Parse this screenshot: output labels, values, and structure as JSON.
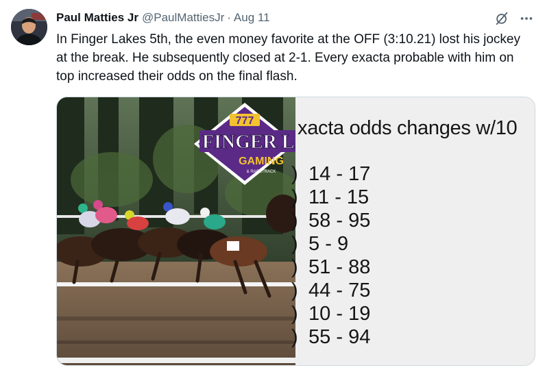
{
  "tweet": {
    "author": {
      "display_name": "Paul Matties Jr",
      "handle": "@PaulMattiesJr",
      "separator": "·",
      "date": "Aug 11"
    },
    "text": "In Finger Lakes 5th, the even money favorite at the OFF (3:10.21) lost his jockey at the break. He subsequently closed at 2-1. Every exacta probable with him on top increased their odds on the final flash."
  },
  "media": {
    "logo_text": {
      "top": "777",
      "main": "FINGER LAK",
      "sub": "GAMING",
      "small": "& RACETRACK"
    },
    "odds_panel": {
      "heading": "xacta odds changes w/10",
      "rows": [
        {
          "prefix": ")",
          "value": " 14 - 17"
        },
        {
          "prefix": ")",
          "value": " 11 - 15"
        },
        {
          "prefix": ")",
          "value": " 58 - 95"
        },
        {
          "prefix": ")",
          "value": " 5 - 9"
        },
        {
          "prefix": ")",
          "value": " 51 - 88"
        },
        {
          "prefix": ")",
          "value": " 44 - 75"
        },
        {
          "prefix": ")",
          "value": " 10 - 19"
        },
        {
          "prefix": ")",
          "value": " 55 - 94"
        }
      ]
    }
  },
  "icons": {
    "grok": "grok-icon",
    "more": "more-icon"
  },
  "colors": {
    "text_primary": "#0f1419",
    "text_secondary": "#536471",
    "logo_purple": "#5b2a86",
    "logo_gold": "#f2c230"
  }
}
